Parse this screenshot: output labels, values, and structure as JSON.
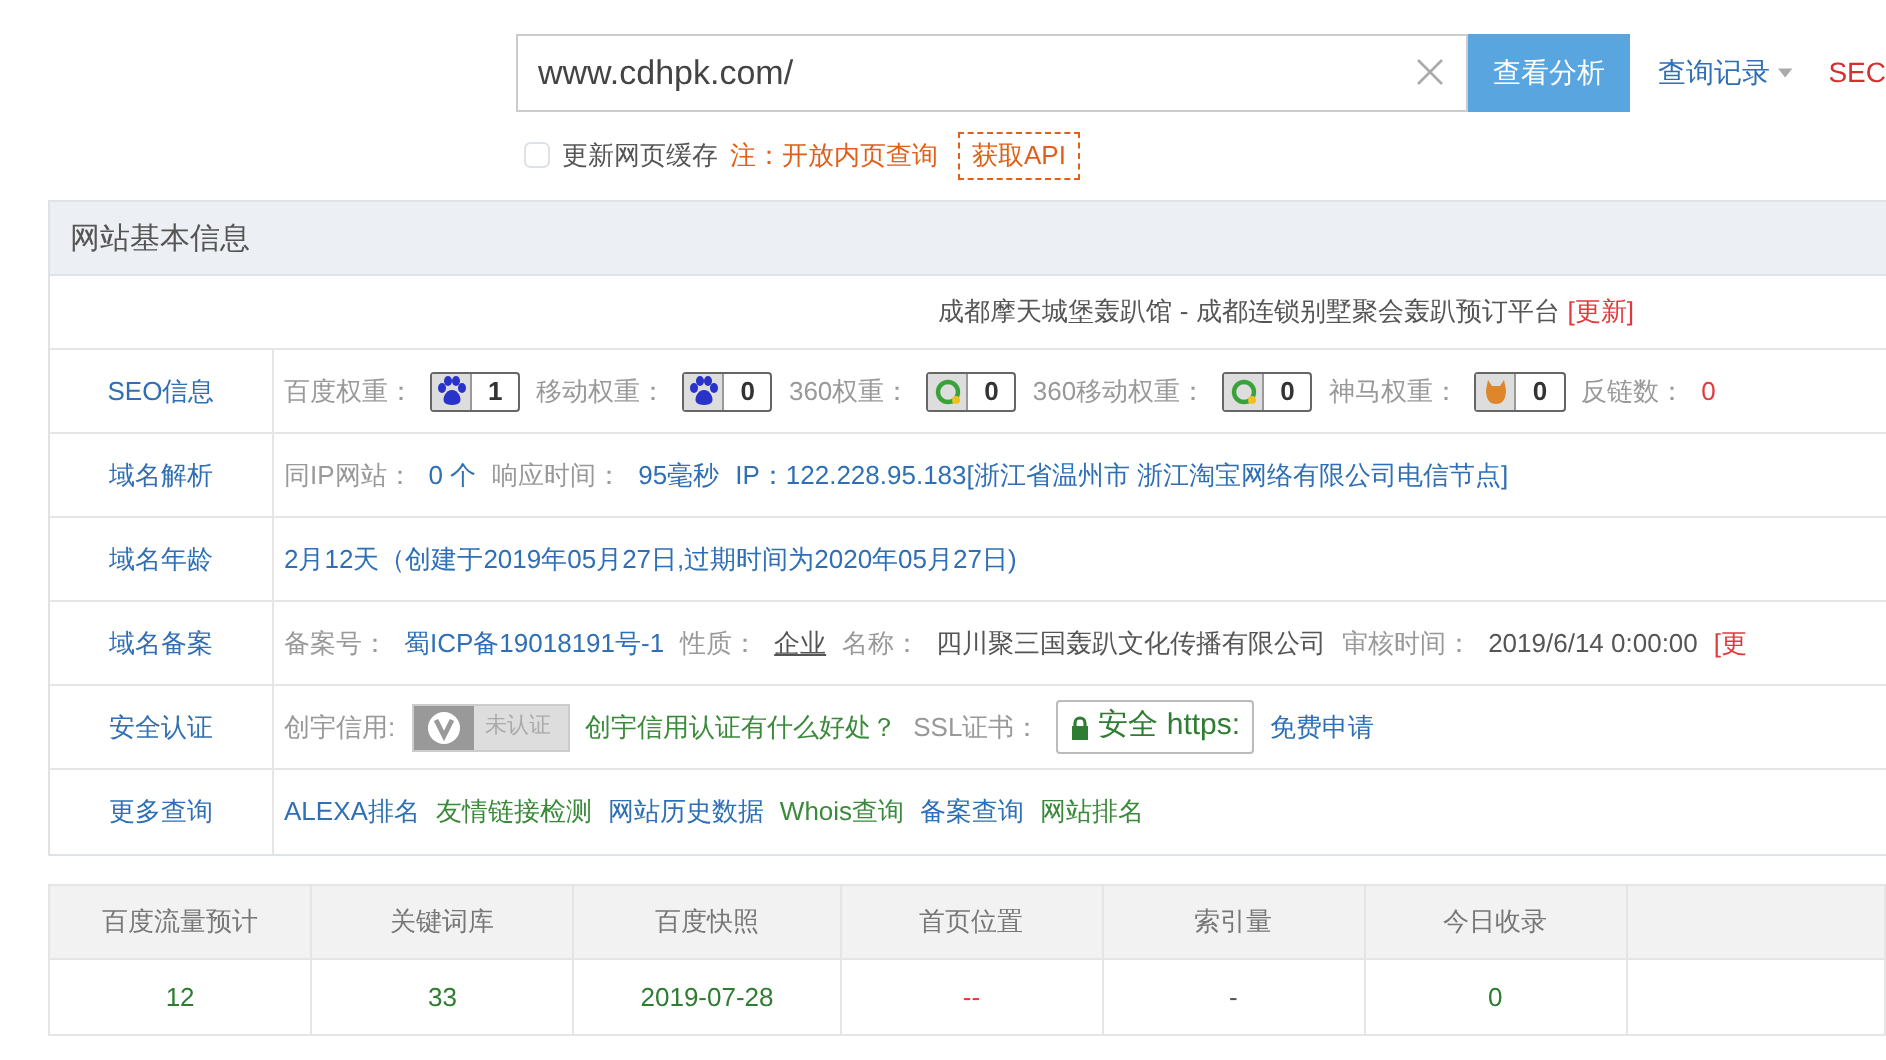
{
  "search": {
    "value": "www.cdhpk.com/",
    "button": "查看分析",
    "history": "查询记录",
    "cut_link": "SEC"
  },
  "options": {
    "cache": {
      "label": "更新网页缓存",
      "checked": false
    },
    "note": "注：开放内页查询",
    "api": "获取API"
  },
  "panel": {
    "title": "网站基本信息",
    "site_title": "成都摩天城堡轰趴馆 - 成都连锁别墅聚会轰趴预订平台",
    "refresh": "[更新]",
    "rows": [
      {
        "label": "SEO信息",
        "items": [
          {
            "kind": "label",
            "text": "百度权重："
          },
          {
            "kind": "paw",
            "text": "1"
          },
          {
            "kind": "label",
            "text": "移动权重："
          },
          {
            "kind": "paw",
            "text": "0"
          },
          {
            "kind": "label",
            "text": "360权重："
          },
          {
            "kind": "ring",
            "text": "0"
          },
          {
            "kind": "label",
            "text": "360移动权重："
          },
          {
            "kind": "ring",
            "text": "0"
          },
          {
            "kind": "label",
            "text": "神马权重："
          },
          {
            "kind": "mascot",
            "text": "0"
          },
          {
            "kind": "label",
            "text": "反链数："
          },
          {
            "kind": "alert",
            "text": "0"
          }
        ]
      },
      {
        "label": "域名解析",
        "items": [
          {
            "kind": "label",
            "text": "同IP网站："
          },
          {
            "kind": "info",
            "text": "0 个"
          },
          {
            "kind": "label",
            "text": "响应时间："
          },
          {
            "kind": "info",
            "text": "95毫秒"
          },
          {
            "kind": "info",
            "text": "IP：122.228.95.183[浙江省温州市 浙江淘宝网络有限公司电信节点]"
          }
        ]
      },
      {
        "label": "域名年龄",
        "items": [
          {
            "kind": "info",
            "text": "2月12天（创建于2019年05月27日,过期时间为2020年05月27日)"
          }
        ]
      },
      {
        "label": "域名备案",
        "items": [
          {
            "kind": "label",
            "text": "备案号："
          },
          {
            "kind": "info",
            "text": "蜀ICP备19018191号-1"
          },
          {
            "kind": "label",
            "text": "性质："
          },
          {
            "kind": "underlined",
            "text": "企业"
          },
          {
            "kind": "label",
            "text": "名称："
          },
          {
            "kind": "plain",
            "text": "四川聚三国轰趴文化传播有限公司"
          },
          {
            "kind": "label",
            "text": "审核时间："
          },
          {
            "kind": "plain",
            "text": "2019/6/14 0:00:00"
          },
          {
            "kind": "alert",
            "text": "[更"
          }
        ]
      },
      {
        "label": "安全认证",
        "items": [
          {
            "kind": "label",
            "text": "创宇信用:"
          },
          {
            "kind": "cert",
            "text": "未认证"
          },
          {
            "kind": "promo",
            "text": "创宇信用认证有什么好处？"
          },
          {
            "kind": "label",
            "text": "SSL证书："
          },
          {
            "kind": "ssl",
            "text": "安全 https:"
          },
          {
            "kind": "info",
            "text": "免费申请"
          }
        ]
      },
      {
        "label": "更多查询",
        "items": [
          {
            "kind": "info",
            "text": "ALEXA排名"
          },
          {
            "kind": "promo",
            "text": "友情链接检测"
          },
          {
            "kind": "info",
            "text": "网站历史数据"
          },
          {
            "kind": "promo",
            "text": "Whois查询"
          },
          {
            "kind": "info",
            "text": "备案查询"
          },
          {
            "kind": "promo",
            "text": "网站排名"
          }
        ]
      }
    ]
  },
  "stats": {
    "columns": [
      "百度流量预计",
      "关键词库",
      "百度快照",
      "首页位置",
      "索引量",
      "今日收录"
    ],
    "values": [
      {
        "kind": "good",
        "text": "12"
      },
      {
        "kind": "good",
        "text": "33"
      },
      {
        "kind": "good",
        "text": "2019-07-28"
      },
      {
        "kind": "bad",
        "text": "--"
      },
      {
        "kind": "none",
        "text": "-"
      },
      {
        "kind": "good",
        "text": "0"
      }
    ]
  }
}
